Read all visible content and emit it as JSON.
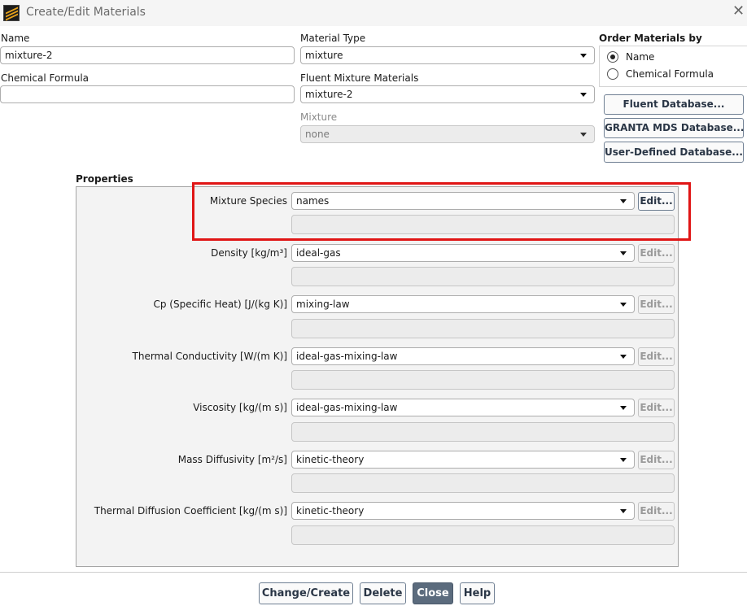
{
  "window": {
    "title": "Create/Edit Materials",
    "close_glyph": "✕"
  },
  "fields": {
    "name_label": "Name",
    "name_value": "mixture-2",
    "chem_formula_label": "Chemical Formula",
    "chem_formula_value": "",
    "material_type_label": "Material Type",
    "material_type_value": "mixture",
    "fluent_mixture_label": "Fluent Mixture Materials",
    "fluent_mixture_value": "mixture-2",
    "mixture_label": "Mixture",
    "mixture_value": "none"
  },
  "order_by": {
    "label": "Order Materials by",
    "options": [
      {
        "label": "Name",
        "selected": true
      },
      {
        "label": "Chemical Formula",
        "selected": false
      }
    ]
  },
  "databases": {
    "fluent": "Fluent Database...",
    "granta": "GRANTA MDS Database...",
    "user": "User-Defined Database..."
  },
  "properties": {
    "title": "Properties",
    "edit_label": "Edit...",
    "rows": [
      {
        "label": "Mixture Species",
        "value": "names",
        "edit_enabled": true
      },
      {
        "label": "Density [kg/m³]",
        "value": "ideal-gas",
        "edit_enabled": false
      },
      {
        "label": "Cp (Specific Heat) [J/(kg K)]",
        "value": "mixing-law",
        "edit_enabled": false
      },
      {
        "label": "Thermal Conductivity [W/(m K)]",
        "value": "ideal-gas-mixing-law",
        "edit_enabled": false
      },
      {
        "label": "Viscosity [kg/(m s)]",
        "value": "ideal-gas-mixing-law",
        "edit_enabled": false
      },
      {
        "label": "Mass Diffusivity [m²/s]",
        "value": "kinetic-theory",
        "edit_enabled": false
      },
      {
        "label": "Thermal Diffusion Coefficient [kg/(m s)]",
        "value": "kinetic-theory",
        "edit_enabled": false
      }
    ]
  },
  "actions": {
    "change_create": "Change/Create",
    "delete": "Delete",
    "close": "Close",
    "help": "Help"
  },
  "colors": {
    "highlight": "#e01515",
    "primary_button": "#5b6b7d"
  }
}
